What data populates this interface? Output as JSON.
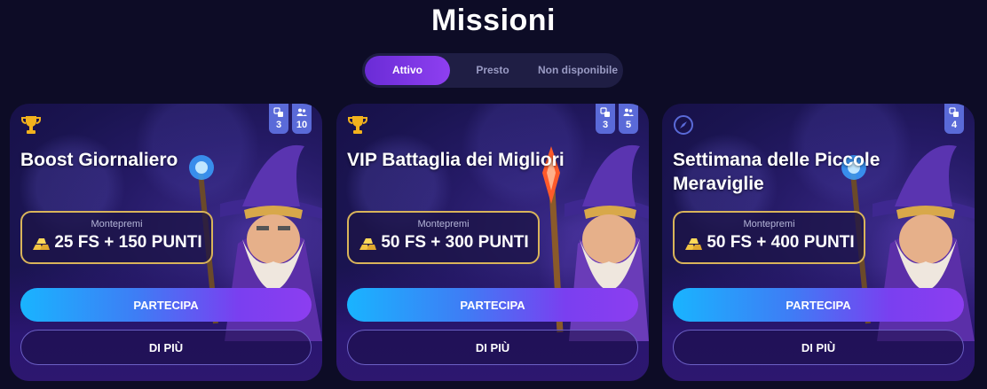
{
  "page": {
    "title": "Missioni"
  },
  "tabs": [
    {
      "label": "Attivo",
      "active": true
    },
    {
      "label": "Presto",
      "active": false
    },
    {
      "label": "Non disponibile",
      "active": false
    }
  ],
  "cards": [
    {
      "icon": "trophy-icon",
      "title": "Boost Giornaliero",
      "badges": [
        {
          "icon": "dice-icon",
          "value": "3"
        },
        {
          "icon": "users-icon",
          "value": "10"
        }
      ],
      "prize_label": "Montepremi",
      "prize_value": "25 FS + 150 PUNTI",
      "primary_button": "PARTECIPA",
      "secondary_button": "DI PIÙ"
    },
    {
      "icon": "trophy-icon",
      "title": "VIP Battaglia dei Migliori",
      "badges": [
        {
          "icon": "dice-icon",
          "value": "3"
        },
        {
          "icon": "users-icon",
          "value": "5"
        }
      ],
      "prize_label": "Montepremi",
      "prize_value": "50 FS + 300 PUNTI",
      "primary_button": "PARTECIPA",
      "secondary_button": "DI PIÙ"
    },
    {
      "icon": "compass-icon",
      "title": "Settimana delle Piccole Meraviglie",
      "badges": [
        {
          "icon": "dice-icon",
          "value": "4"
        }
      ],
      "prize_label": "Montepremi",
      "prize_value": "50 FS + 400 PUNTI",
      "primary_button": "PARTECIPA",
      "secondary_button": "DI PIÙ"
    }
  ],
  "colors": {
    "background": "#0d0c26",
    "tab_active": "#7a35e6",
    "prize_border": "#d9b45a",
    "badge": "#5a6ad8",
    "trophy": "#f2b21d",
    "compass": "#5a6ad8"
  }
}
